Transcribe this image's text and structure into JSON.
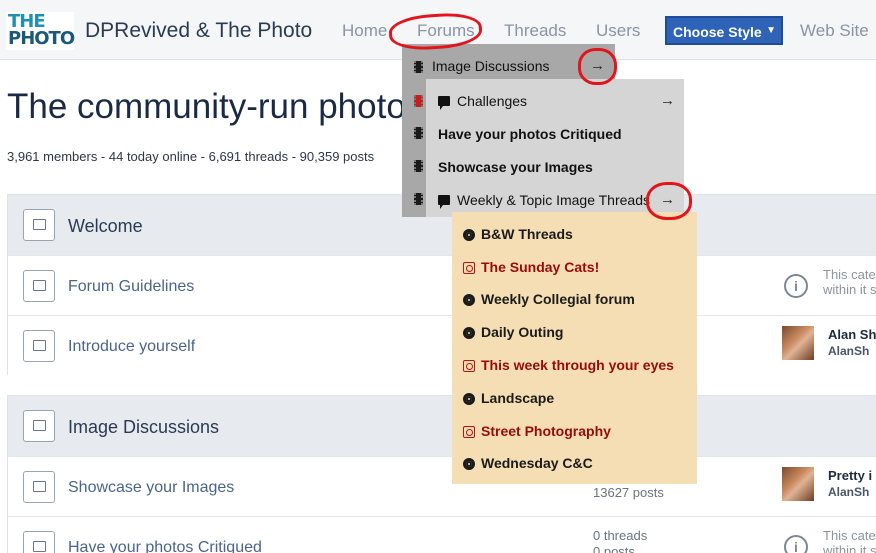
{
  "header": {
    "logo_line1": "THE",
    "logo_line2": "PHOTO",
    "site_title": "DPRevived & The Photo",
    "nav": [
      "Home",
      "Forums",
      "Threads",
      "Users"
    ],
    "style_button": "Choose Style",
    "web_site": "Web Site"
  },
  "main": {
    "title": "The community-run photo",
    "stats": "3,961 members - 44 today online - 6,691 threads - 90,359 posts"
  },
  "categories": [
    {
      "title": "Welcome",
      "forums": [
        {
          "title": "Forum Guidelines",
          "info_text": [
            "This cate",
            "within it s"
          ]
        },
        {
          "title": "Introduce yourself",
          "last_post": "Alan Sh",
          "last_user": "AlanSh"
        }
      ]
    },
    {
      "title": "Image Discussions",
      "forums": [
        {
          "title": "Showcase your Images",
          "posts": "13627 posts",
          "last_post": "Pretty i",
          "last_user": "AlanSh"
        },
        {
          "title": "Have your photos Critiqued",
          "threads": "0 threads",
          "posts": "0 posts",
          "info_text": [
            "This cate",
            "within it s"
          ]
        }
      ]
    }
  ],
  "menu_level1": {
    "items": [
      "Image Discussions"
    ]
  },
  "menu_level2": {
    "items": [
      "Challenges",
      "Have your photos Critiqued",
      "Showcase your Images",
      "Weekly & Topic Image Threads"
    ]
  },
  "menu_level3": {
    "items": [
      {
        "label": "B&W Threads",
        "color": "#1a1a1a"
      },
      {
        "label": "The Sunday Cats!",
        "color": "#9b0a0a"
      },
      {
        "label": "Weekly Collegial forum",
        "color": "#1a1a1a"
      },
      {
        "label": "Daily Outing",
        "color": "#1a1a1a"
      },
      {
        "label": "This week through your eyes",
        "color": "#9b0a0a"
      },
      {
        "label": "Landscape",
        "color": "#1a1a1a"
      },
      {
        "label": "Street Photography",
        "color": "#9b0a0a"
      },
      {
        "label": "Wednesday C&C",
        "color": "#1a1a1a"
      }
    ]
  },
  "colors": {
    "accent": "#2e63b8",
    "annotation": "#e3141b",
    "submenu_bg": "#f5deb3"
  }
}
